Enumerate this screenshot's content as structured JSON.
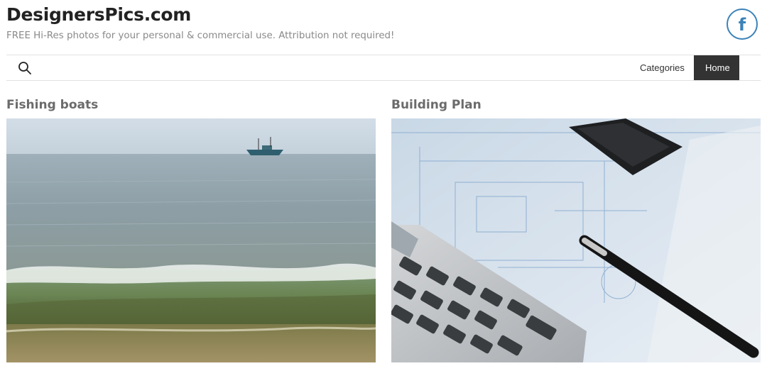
{
  "header": {
    "site_title": "DesignersPics.com",
    "tagline": "FREE Hi-Res photos for your personal & commercial use. Attribution not required!",
    "social_icon": "facebook-icon"
  },
  "nav": {
    "search_icon": "search-icon",
    "items": [
      {
        "label": "Categories",
        "active": false
      },
      {
        "label": "Home",
        "active": true
      }
    ]
  },
  "posts": [
    {
      "title": "Fishing boats",
      "image": "fishing-boat-sea-photo"
    },
    {
      "title": "Building Plan",
      "image": "calculator-pen-blueprint-photo"
    }
  ],
  "colors": {
    "title_text": "#222222",
    "tagline_text": "#8a8a8a",
    "facebook_blue": "#3b82b8",
    "nav_active_bg": "#333333",
    "post_title_text": "#6b6b6b"
  }
}
